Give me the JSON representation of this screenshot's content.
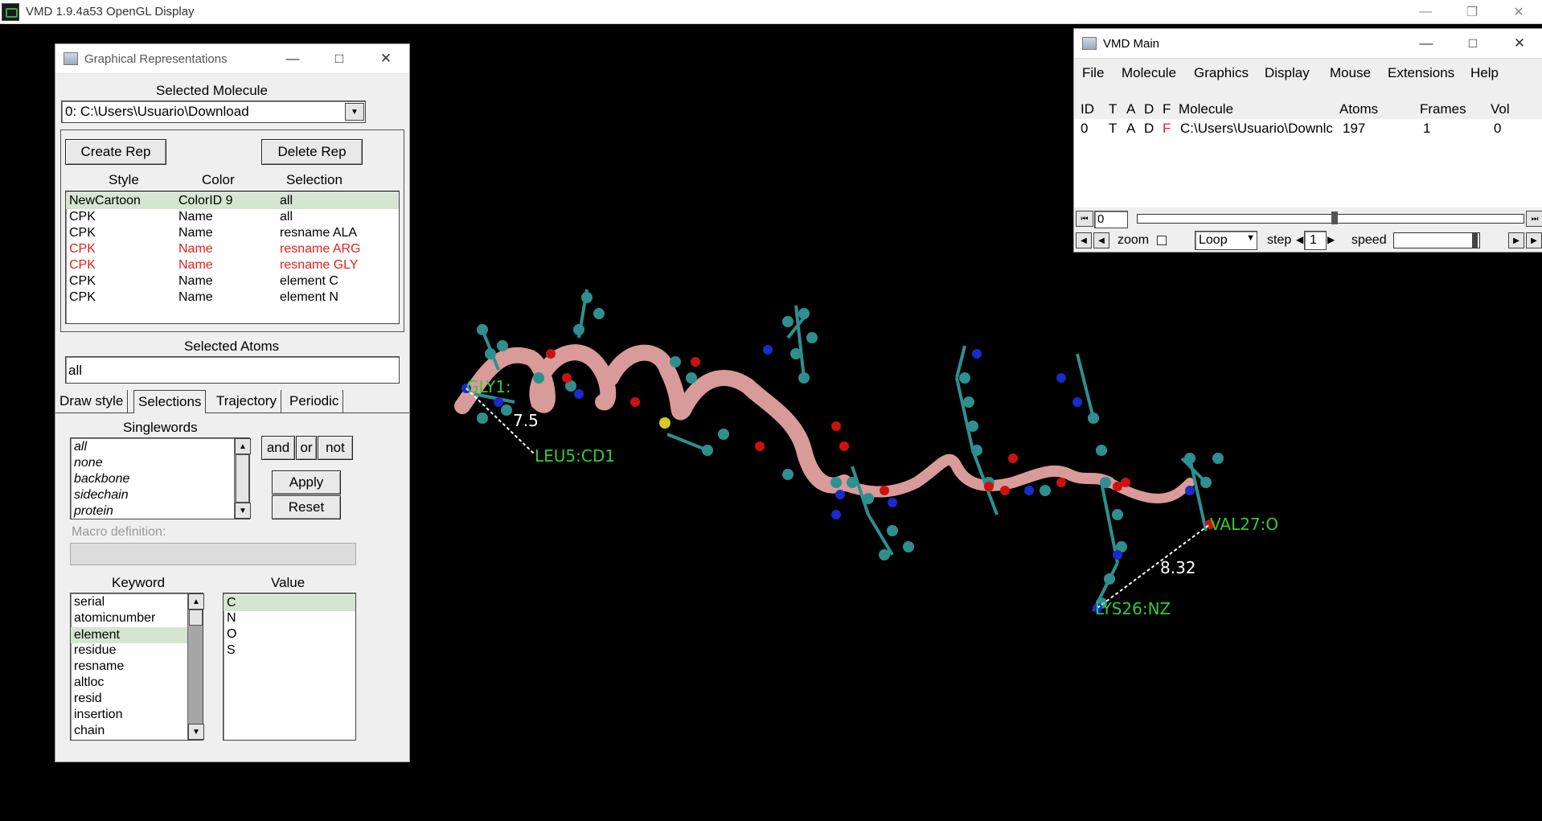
{
  "window": {
    "title": "VMD 1.9.4a53 OpenGL Display"
  },
  "scene": {
    "labels": [
      {
        "text": "GLY1:",
        "color": "#33cc33"
      },
      {
        "text": "7.5",
        "color": "#ffffff"
      },
      {
        "text": "LEU5:CD1",
        "color": "#33cc33"
      },
      {
        "text": "VAL27:O",
        "color": "#33cc33"
      },
      {
        "text": "8.32",
        "color": "#ffffff"
      },
      {
        "text": "LYS26:NZ",
        "color": "#33cc33"
      }
    ]
  },
  "graphrep": {
    "title": "Graphical Representations",
    "selected_molecule_label": "Selected Molecule",
    "molecule_value": "0: C:\\Users\\Usuario\\Download",
    "create_rep": "Create Rep",
    "delete_rep": "Delete Rep",
    "columns": [
      "Style",
      "Color",
      "Selection"
    ],
    "reps": [
      {
        "style": "NewCartoon",
        "color": "ColorID 9",
        "selection": "all",
        "selected": true,
        "disabled": false
      },
      {
        "style": "CPK",
        "color": "Name",
        "selection": "all",
        "selected": false,
        "disabled": false
      },
      {
        "style": "CPK",
        "color": "Name",
        "selection": "resname ALA",
        "selected": false,
        "disabled": false
      },
      {
        "style": "CPK",
        "color": "Name",
        "selection": "resname ARG",
        "selected": false,
        "disabled": true
      },
      {
        "style": "CPK",
        "color": "Name",
        "selection": "resname GLY",
        "selected": false,
        "disabled": true
      },
      {
        "style": "CPK",
        "color": "Name",
        "selection": "element C",
        "selected": false,
        "disabled": false
      },
      {
        "style": "CPK",
        "color": "Name",
        "selection": "element N",
        "selected": false,
        "disabled": false
      }
    ],
    "selected_atoms_label": "Selected Atoms",
    "selected_atoms_value": "all",
    "tabs": [
      "Draw style",
      "Selections",
      "Trajectory",
      "Periodic"
    ],
    "active_tab": "Selections",
    "singlewords_label": "Singlewords",
    "singlewords": [
      "all",
      "none",
      "backbone",
      "sidechain",
      "protein"
    ],
    "and": "and",
    "or": "or",
    "not": "not",
    "apply": "Apply",
    "reset": "Reset",
    "macro_label": "Macro definition:",
    "keyword_label": "Keyword",
    "keywords": [
      "serial",
      "atomicnumber",
      "element",
      "residue",
      "resname",
      "altloc",
      "resid",
      "insertion",
      "chain"
    ],
    "selected_keyword": "element",
    "value_label": "Value",
    "values": [
      "C",
      "N",
      "O",
      "S"
    ],
    "selected_value": "C"
  },
  "vmdmain": {
    "title": "VMD Main",
    "menu": [
      "File",
      "Molecule",
      "Graphics",
      "Display",
      "Mouse",
      "Extensions",
      "Help"
    ],
    "headers": {
      "id": "ID",
      "t": "T",
      "a": "A",
      "d": "D",
      "f": "F",
      "molecule": "Molecule",
      "atoms": "Atoms",
      "frames": "Frames",
      "vol": "Vol"
    },
    "row": {
      "id": "0",
      "t": "T",
      "a": "A",
      "d": "D",
      "f": "F",
      "molecule": "C:\\Users\\Usuario\\Downlc",
      "atoms": "197",
      "frames": "1",
      "vol": "0"
    },
    "frame_value": "0",
    "zoom": "zoom",
    "loop": "Loop",
    "step_label": "step",
    "step_value": "1",
    "speed_label": "speed"
  }
}
